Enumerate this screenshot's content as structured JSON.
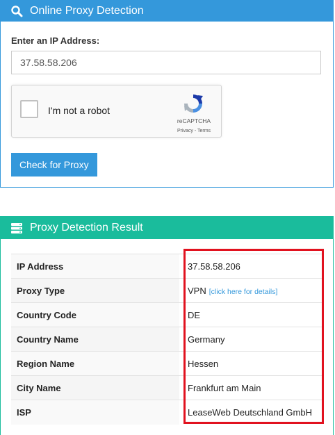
{
  "detection_panel": {
    "title": "Online Proxy Detection",
    "icon": "search-icon",
    "ip_label": "Enter an IP Address:",
    "ip_value": "37.58.58.206",
    "recaptcha": {
      "label": "I'm not a robot",
      "brand": "reCAPTCHA",
      "links": "Privacy - Terms",
      "checked": false
    },
    "check_button": "Check for Proxy",
    "accent_color": "#3498db"
  },
  "result_panel": {
    "title": "Proxy Detection Result",
    "icon": "server-icon",
    "accent_color": "#1abc9c",
    "rows": [
      {
        "key": "IP Address",
        "value": "37.58.58.206"
      },
      {
        "key": "Proxy Type",
        "value": "VPN",
        "link": "[click here for details]"
      },
      {
        "key": "Country Code",
        "value": "DE"
      },
      {
        "key": "Country Name",
        "value": "Germany"
      },
      {
        "key": "Region Name",
        "value": "Hessen"
      },
      {
        "key": "City Name",
        "value": "Frankfurt am Main"
      },
      {
        "key": "ISP",
        "value": "LeaseWeb Deutschland GmbH"
      }
    ],
    "highlight_color": "#e1121f"
  }
}
